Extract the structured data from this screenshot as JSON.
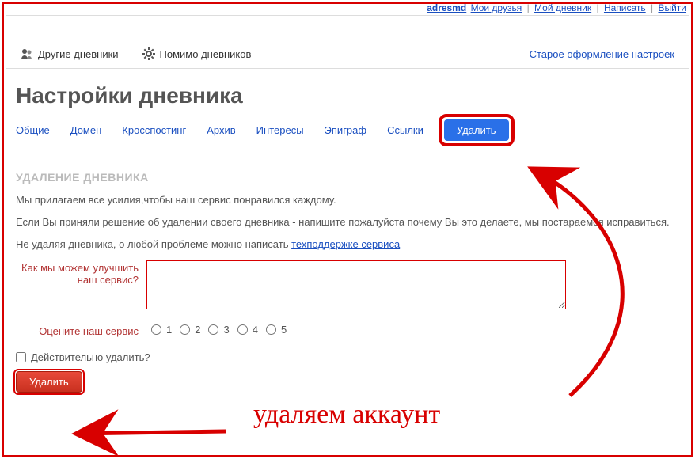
{
  "topbar": {
    "user": "adresmd",
    "links": [
      "Мои друзья",
      "Мой дневник",
      "Написать",
      "Выйти"
    ]
  },
  "nav": {
    "other_diaries": "Другие дневники",
    "besides_diaries": "Помимо дневников",
    "old_design": "Старое оформление настроек"
  },
  "page_title": "Настройки дневника",
  "tabs": {
    "general": "Общие",
    "domain": "Домен",
    "crossposting": "Кросспостинг",
    "archive": "Архив",
    "interests": "Интересы",
    "epigraph": "Эпиграф",
    "links": "Ссылки",
    "delete": "Удалить"
  },
  "section_heading": "УДАЛЕНИЕ ДНЕВНИКА",
  "paragraphs": {
    "p1": "Мы прилагаем все усилия,чтобы наш сервис понравился каждому.",
    "p2": "Если Вы приняли решение об удалении своего дневника - напишите пожалуйста почему Вы это делаете, мы постараемся исправиться.",
    "p3_prefix": "Не удаляя дневника, о любой проблеме можно написать ",
    "p3_link": "техподдержке сервиса"
  },
  "form": {
    "improve_label": "Как мы можем улучшить наш сервис?",
    "rate_label": "Оцените наш сервис",
    "ratings": [
      "1",
      "2",
      "3",
      "4",
      "5"
    ],
    "confirm_label": "Действительно удалить?",
    "delete_button": "Удалить"
  },
  "annotation": "удаляем аккаунт"
}
